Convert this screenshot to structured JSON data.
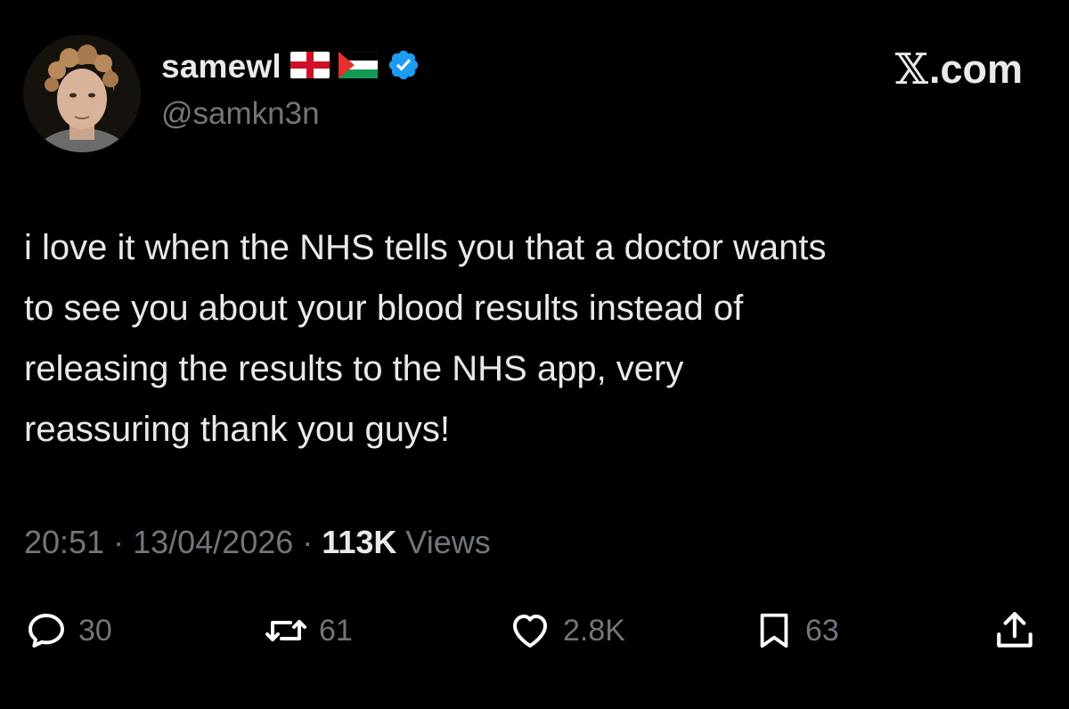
{
  "user": {
    "display_name": "samewl",
    "handle": "@samkn3n",
    "flags": [
      "england-flag-icon",
      "palestine-flag-icon"
    ],
    "verified_icon": "verified-badge-icon",
    "avatar_icon": "avatar-photo"
  },
  "brand": {
    "label": ".com",
    "icon": "x-logo-icon"
  },
  "tweet": {
    "text": "i love it when the NHS tells you that a doctor wants\nto see you about your blood results instead of\nreleasing the results to the NHS app, very\nreassuring thank you guys!"
  },
  "meta": {
    "time": "20:51",
    "separator": " · ",
    "date": "13/04/2026",
    "views_count": "113K",
    "views_label": " Views"
  },
  "actions": {
    "replies": {
      "count": "30",
      "icon": "reply-icon"
    },
    "reposts": {
      "count": "61",
      "icon": "repost-icon"
    },
    "likes": {
      "count": "2.8K",
      "icon": "heart-icon"
    },
    "bookmarks": {
      "count": "63",
      "icon": "bookmark-icon"
    },
    "share": {
      "icon": "share-icon"
    }
  },
  "colors": {
    "background": "#000000",
    "primary_text": "#e7e9ea",
    "secondary_text": "#71767b",
    "verified_blue": "#1d9bf0"
  }
}
